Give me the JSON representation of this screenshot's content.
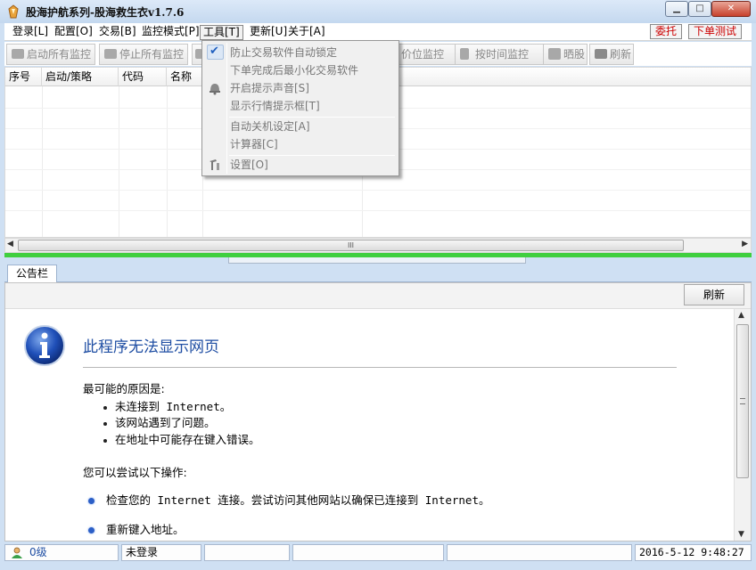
{
  "window": {
    "title": "股海护航系列-股海救生衣v1.7.6",
    "min_label": "▁",
    "max_label": "□",
    "close_label": "✕"
  },
  "menubar": {
    "items": [
      "登录[L]",
      "配置[O]",
      "交易[B]",
      "监控模式[P]",
      "工具[T]",
      "更新[U]",
      "关于[A]"
    ],
    "entrust": "委托",
    "order_test": "下单测试"
  },
  "toolbar": {
    "start_all": "启动所有监控",
    "stop_all": "停止所有监控",
    "price_monitor": "价位监控",
    "time_monitor": "按时间监控",
    "bask": "晒股",
    "refresh": "刷新"
  },
  "grid": {
    "columns": [
      "序号",
      "启动/策略",
      "代码",
      "名称"
    ]
  },
  "scrollbar": {
    "grip": "III"
  },
  "tools_menu": {
    "items": [
      {
        "label": "防止交易软件自动锁定",
        "checked": true
      },
      {
        "label": "下单完成后最小化交易软件"
      },
      {
        "label": "开启提示声音[S]",
        "icon": "bell-icon"
      },
      {
        "label": "显示行情提示框[T]"
      },
      {
        "label": "自动关机设定[A]"
      },
      {
        "label": "计算器[C]"
      },
      {
        "label": "设置[O]",
        "icon": "tools-icon"
      }
    ]
  },
  "bulletin": {
    "tab": "公告栏",
    "refresh": "刷新",
    "error_title": "此程序无法显示网页",
    "reason_head": "最可能的原因是:",
    "reasons": [
      "未连接到 Internet。",
      "该网站遇到了问题。",
      "在地址中可能存在键入错误。"
    ],
    "try_head": "您可以尝试以下操作:",
    "tries": [
      "检查您的 Internet 连接。尝试访问其他网站以确保已连接到 Internet。",
      "重新键入地址。"
    ]
  },
  "statusbar": {
    "level": "0级",
    "login": "未登录",
    "datetime": "2016-5-12  9:48:27"
  },
  "colors": {
    "accent_blue": "#1f4ea3",
    "progress_green": "#3fcf3f",
    "red_button_text": "#cc0000"
  }
}
